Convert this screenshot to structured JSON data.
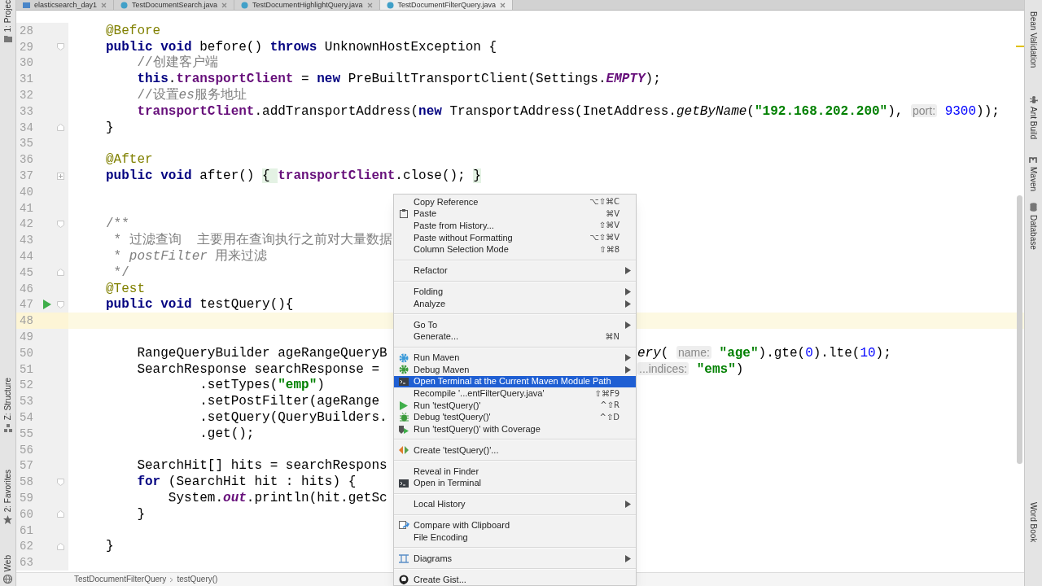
{
  "tabs": [
    {
      "label": "elasticsearch_day1",
      "selected": false
    },
    {
      "label": "TestDocumentSearch.java",
      "selected": false
    },
    {
      "label": "TestDocumentHighlightQuery.java",
      "selected": false
    },
    {
      "label": "TestDocumentFilterQuery.java",
      "selected": true
    }
  ],
  "left_tool_strip": [
    "1: Projec",
    "Z: Structure",
    "2: Favorites",
    "Web"
  ],
  "right_tool_strip": [
    "Bean Validation",
    "Ant Build",
    "Maven",
    "Database",
    "Word Book"
  ],
  "code_lines": [
    {
      "number": "28",
      "tokens": [
        {
          "kind": "ann",
          "text": "    @Before"
        }
      ]
    },
    {
      "number": "29",
      "fold_start": true,
      "tokens": [
        {
          "kind": "kw",
          "text": "    public "
        },
        {
          "kind": "kw",
          "text": "void"
        },
        {
          "kind": "plain",
          "text": " before() "
        },
        {
          "kind": "kw",
          "text": "throws"
        },
        {
          "kind": "plain",
          "text": " UnknownHostException {"
        }
      ]
    },
    {
      "number": "30",
      "tokens": [
        {
          "kind": "comment",
          "text": "        //创建客户端"
        }
      ]
    },
    {
      "number": "31",
      "tokens": [
        {
          "kind": "kw",
          "text": "        this"
        },
        {
          "kind": "plain",
          "text": "."
        },
        {
          "kind": "field",
          "text": "transportClient"
        },
        {
          "kind": "plain",
          "text": " = "
        },
        {
          "kind": "kw",
          "text": "new"
        },
        {
          "kind": "plain",
          "text": " PreBuiltTransportClient(Settings."
        },
        {
          "kind": "static",
          "text": "EMPTY"
        },
        {
          "kind": "plain",
          "text": ");"
        }
      ]
    },
    {
      "number": "32",
      "tokens": [
        {
          "kind": "comment",
          "text": "        //设置"
        },
        {
          "kind": "comment_em",
          "text": "es"
        },
        {
          "kind": "comment",
          "text": "服务地址"
        }
      ]
    },
    {
      "number": "33",
      "tokens": [
        {
          "kind": "field",
          "text": "        transportClient"
        },
        {
          "kind": "plain",
          "text": ".addTransportAddress("
        },
        {
          "kind": "kw",
          "text": "new"
        },
        {
          "kind": "plain",
          "text": " TransportAddress(InetAddress."
        },
        {
          "kind": "italic",
          "text": "getByName"
        },
        {
          "kind": "plain",
          "text": "("
        },
        {
          "kind": "str",
          "text": "\"192.168.202.200\""
        },
        {
          "kind": "plain",
          "text": "), "
        },
        {
          "kind": "hint",
          "text": "port:"
        },
        {
          "kind": "num",
          "text": " 9300"
        },
        {
          "kind": "plain",
          "text": "));"
        }
      ]
    },
    {
      "number": "34",
      "fold_end": true,
      "tokens": [
        {
          "kind": "plain",
          "text": "    }"
        }
      ]
    },
    {
      "number": "35"
    },
    {
      "number": "36",
      "tokens": [
        {
          "kind": "ann",
          "text": "    @After"
        }
      ]
    },
    {
      "number": "37",
      "folded": true,
      "tokens": [
        {
          "kind": "kw",
          "text": "    public "
        },
        {
          "kind": "kw",
          "text": "void"
        },
        {
          "kind": "plain",
          "text": " after() "
        },
        {
          "kind": "folded",
          "text": "{ "
        },
        {
          "kind": "field",
          "text": "transportClient"
        },
        {
          "kind": "plain",
          "text": ".close(); "
        },
        {
          "kind": "folded",
          "text": "}"
        }
      ]
    },
    {
      "number": "40"
    },
    {
      "number": "41"
    },
    {
      "number": "42",
      "fold_start": true,
      "tokens": [
        {
          "kind": "doc",
          "text": "    /**"
        }
      ]
    },
    {
      "number": "43",
      "tokens": [
        {
          "kind": "doc",
          "text": "     * 过滤查询  主要用在查询执行之前对大量数据"
        }
      ]
    },
    {
      "number": "44",
      "tokens": [
        {
          "kind": "doc",
          "text": "     * "
        },
        {
          "kind": "doc_em",
          "text": "postFilter"
        },
        {
          "kind": "doc",
          "text": " 用来过滤"
        }
      ]
    },
    {
      "number": "45",
      "fold_end": true,
      "tokens": [
        {
          "kind": "doc",
          "text": "     */"
        }
      ]
    },
    {
      "number": "46",
      "tokens": [
        {
          "kind": "ann",
          "text": "    @Test"
        }
      ]
    },
    {
      "number": "47",
      "run": true,
      "fold_start": true,
      "tokens": [
        {
          "kind": "kw",
          "text": "    public "
        },
        {
          "kind": "kw",
          "text": "void"
        },
        {
          "kind": "plain",
          "text": " testQuery(){"
        }
      ]
    },
    {
      "number": "48",
      "current": true
    },
    {
      "number": "49"
    },
    {
      "number": "50",
      "tokens": [
        {
          "kind": "plain",
          "text": "        RangeQueryBuilder ageRangeQueryB"
        }
      ],
      "after_menu": [
        {
          "kind": "italic",
          "text": "ery"
        },
        {
          "kind": "plain",
          "text": "( "
        },
        {
          "kind": "hint",
          "text": "name:"
        },
        {
          "kind": "str",
          "text": " \"age\""
        },
        {
          "kind": "plain",
          "text": ").gte("
        },
        {
          "kind": "num",
          "text": "0"
        },
        {
          "kind": "plain",
          "text": ").lte("
        },
        {
          "kind": "num",
          "text": "10"
        },
        {
          "kind": "plain",
          "text": ");"
        }
      ]
    },
    {
      "number": "51",
      "tokens": [
        {
          "kind": "plain",
          "text": "        SearchResponse searchResponse ="
        }
      ],
      "after_menu": [
        {
          "kind": "hint",
          "text": "...indices:"
        },
        {
          "kind": "str",
          "text": " \"ems\""
        },
        {
          "kind": "plain",
          "text": ")"
        }
      ]
    },
    {
      "number": "52",
      "tokens": [
        {
          "kind": "plain",
          "text": "                .setTypes("
        },
        {
          "kind": "str",
          "text": "\"emp\""
        },
        {
          "kind": "plain",
          "text": ")"
        }
      ]
    },
    {
      "number": "53",
      "tokens": [
        {
          "kind": "plain",
          "text": "                .setPostFilter(ageRange"
        }
      ]
    },
    {
      "number": "54",
      "tokens": [
        {
          "kind": "plain",
          "text": "                .setQuery(QueryBuilders."
        }
      ]
    },
    {
      "number": "55",
      "tokens": [
        {
          "kind": "plain",
          "text": "                .get();"
        }
      ]
    },
    {
      "number": "56"
    },
    {
      "number": "57",
      "tokens": [
        {
          "kind": "plain",
          "text": "        SearchHit[] hits = searchRespons"
        }
      ]
    },
    {
      "number": "58",
      "fold_start": true,
      "tokens": [
        {
          "kind": "kw",
          "text": "        for"
        },
        {
          "kind": "plain",
          "text": " (SearchHit hit : hits) {"
        }
      ]
    },
    {
      "number": "59",
      "tokens": [
        {
          "kind": "plain",
          "text": "            System."
        },
        {
          "kind": "static",
          "text": "out"
        },
        {
          "kind": "plain",
          "text": ".println(hit.getSc"
        }
      ]
    },
    {
      "number": "60",
      "fold_end": true,
      "tokens": [
        {
          "kind": "plain",
          "text": "        }"
        }
      ]
    },
    {
      "number": "61"
    },
    {
      "number": "62",
      "fold_end": true,
      "tokens": [
        {
          "kind": "plain",
          "text": "    }"
        }
      ]
    },
    {
      "number": "63"
    }
  ],
  "context_menu": [
    [
      {
        "label": "Copy Reference",
        "shortcut": "⌥⇧⌘C",
        "submenu": false,
        "selected": false
      },
      {
        "label": "Paste",
        "shortcut": "⌘V",
        "submenu": false,
        "selected": false
      },
      {
        "label": "Paste from History...",
        "shortcut": "⇧⌘V",
        "submenu": false,
        "selected": false
      },
      {
        "label": "Paste without Formatting",
        "shortcut": "⌥⇧⌘V",
        "submenu": false,
        "selected": false
      },
      {
        "label": "Column Selection Mode",
        "shortcut": "⇧⌘8",
        "submenu": false,
        "selected": false
      }
    ],
    [
      {
        "label": "Refactor",
        "submenu": true,
        "selected": false
      }
    ],
    [
      {
        "label": "Folding",
        "submenu": true,
        "selected": false
      },
      {
        "label": "Analyze",
        "submenu": true,
        "selected": false
      }
    ],
    [
      {
        "label": "Go To",
        "submenu": true,
        "selected": false
      },
      {
        "label": "Generate...",
        "shortcut": "⌘N",
        "submenu": false,
        "selected": false
      }
    ],
    [
      {
        "label": "Run Maven",
        "submenu": true,
        "selected": false
      },
      {
        "label": "Debug Maven",
        "submenu": true,
        "selected": false
      },
      {
        "label": "Open Terminal at the Current Maven Module Path",
        "submenu": false,
        "selected": true
      },
      {
        "label": "Recompile '...entFilterQuery.java'",
        "shortcut": "⇧⌘F9",
        "submenu": false,
        "selected": false
      },
      {
        "label": "Run 'testQuery()'",
        "shortcut": "^⇧R",
        "submenu": false,
        "selected": false
      },
      {
        "label": "Debug 'testQuery()'",
        "shortcut": "^⇧D",
        "submenu": false,
        "selected": false
      },
      {
        "label": "Run 'testQuery()' with Coverage",
        "submenu": false,
        "selected": false
      }
    ],
    [
      {
        "label": "Create 'testQuery()'...",
        "submenu": false,
        "selected": false
      }
    ],
    [
      {
        "label": "Reveal in Finder",
        "submenu": false,
        "selected": false
      },
      {
        "label": "Open in Terminal",
        "submenu": false,
        "selected": false
      }
    ],
    [
      {
        "label": "Local History",
        "submenu": true,
        "selected": false
      }
    ],
    [
      {
        "label": "Compare with Clipboard",
        "submenu": false,
        "selected": false
      },
      {
        "label": "File Encoding",
        "submenu": false,
        "selected": false
      }
    ],
    [
      {
        "label": "Diagrams",
        "submenu": true,
        "selected": false
      }
    ],
    [
      {
        "label": "Create Gist...",
        "submenu": false,
        "selected": false
      }
    ]
  ],
  "breadcrumb": [
    "TestDocumentFilterQuery",
    "testQuery()"
  ]
}
